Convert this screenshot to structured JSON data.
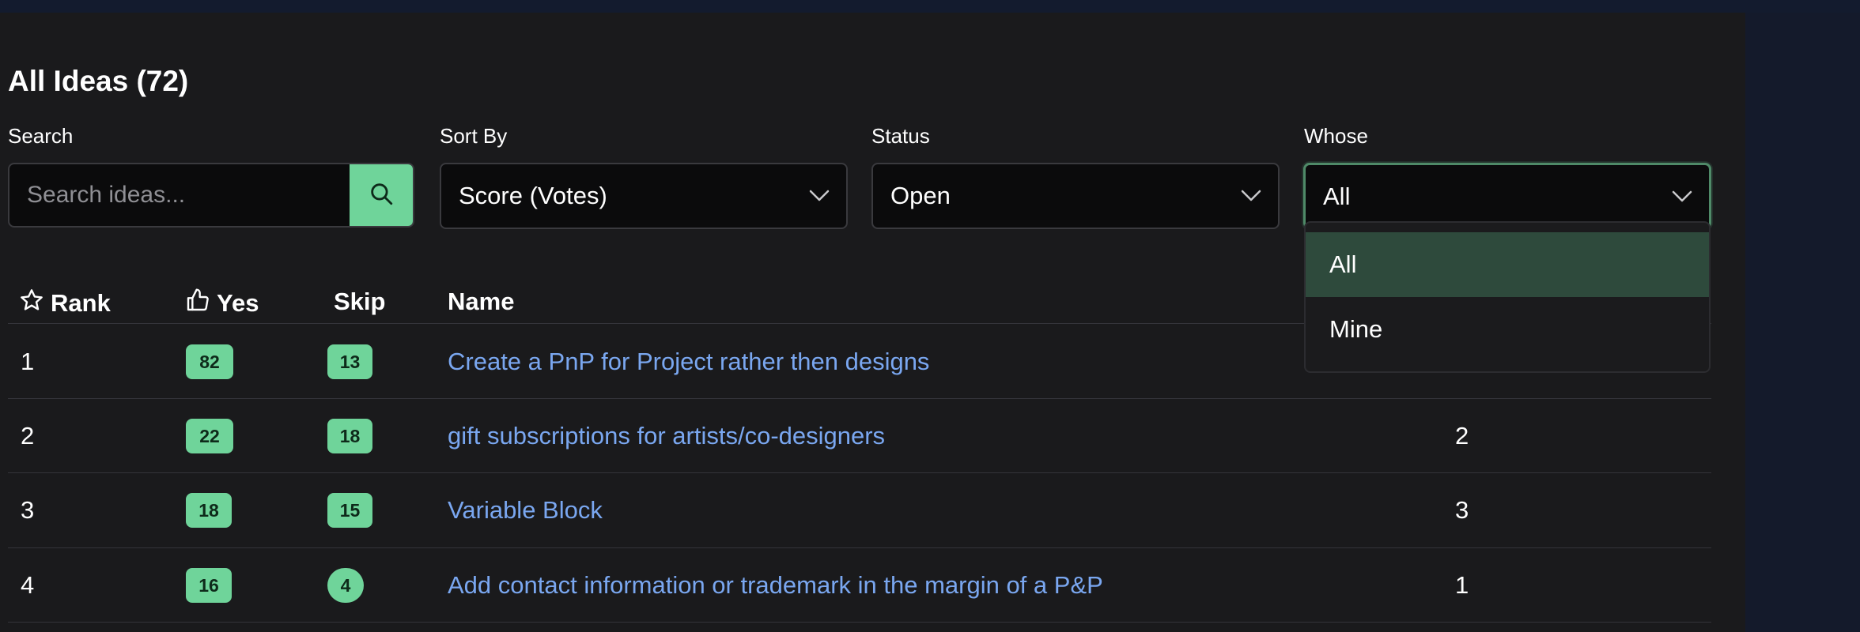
{
  "page": {
    "title": "All Ideas (72)"
  },
  "filters": {
    "search": {
      "label": "Search",
      "placeholder": "Search ideas..."
    },
    "sort_by": {
      "label": "Sort By",
      "value": "Score (Votes)"
    },
    "status": {
      "label": "Status",
      "value": "Open"
    },
    "whose": {
      "label": "Whose",
      "value": "All",
      "options": [
        "All",
        "Mine"
      ],
      "selected": "All"
    }
  },
  "table": {
    "headers": {
      "rank": "Rank",
      "yes": "Yes",
      "skip": "Skip",
      "name": "Name"
    },
    "rows": [
      {
        "rank": "1",
        "yes": "82",
        "skip": "13",
        "name": "Create a PnP for Project rather then designs",
        "extra": ""
      },
      {
        "rank": "2",
        "yes": "22",
        "skip": "18",
        "name": "gift subscriptions for artists/co-designers",
        "extra": "2"
      },
      {
        "rank": "3",
        "yes": "18",
        "skip": "15",
        "name": "Variable Block",
        "extra": "3"
      },
      {
        "rank": "4",
        "yes": "16",
        "skip": "4",
        "name": "Add contact information or trademark in the margin of a P&P",
        "extra": "1"
      }
    ]
  },
  "colors": {
    "accent_green": "#6fd49a",
    "link_blue": "#7aa7f0",
    "selected_option_bg": "#2e4a3c",
    "panel_bg": "#1a1a1c"
  },
  "icons": {
    "search_button": "search-icon",
    "select_chevron": "chevron-down-icon",
    "rank_header": "star-icon",
    "yes_header": "thumbs-up-icon"
  }
}
